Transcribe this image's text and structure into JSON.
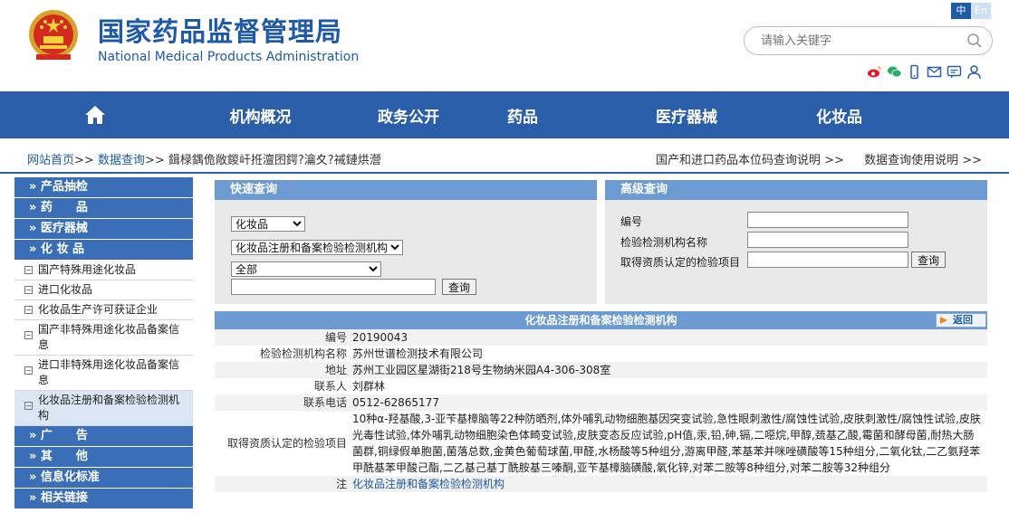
{
  "header": {
    "title_cn": "国家药品监督管理局",
    "title_en": "National Medical Products Administration",
    "lang_zh": "中",
    "lang_en": "En",
    "search_placeholder": "请输入关键字",
    "social_icons": [
      "weibo-icon",
      "wechat-icon",
      "mobile-icon",
      "mail-icon",
      "message-icon",
      "user-icon"
    ]
  },
  "nav": {
    "home_icon": "home-icon",
    "items": [
      "机构概况",
      "政务公开",
      "药品",
      "医疗器械",
      "化妆品"
    ]
  },
  "breadcrumb": {
    "home": "网站首页",
    "sep": ">>",
    "query": "数据查询",
    "current": "鍓椂鍝佹敞鍐屽拰澶囨鍔?瀹夊?祴鏈烘瀯",
    "right_link1": "国产和进口药品本位码查询说明 >>",
    "right_link2": "数据查询使用说明 >>"
  },
  "sidebar": {
    "cat1": "» 产品抽检",
    "cat2": "» 药　　品",
    "cat3": "» 医疗器械",
    "cat4": "» 化 妆 品",
    "subs": [
      "国产特殊用途化妆品",
      "进口化妆品",
      "化妆品生产许可获证企业",
      "国产非特殊用途化妆品备案信息",
      "进口非特殊用途化妆品备案信息",
      "化妆品注册和备案检验检测机构"
    ],
    "cat5": "» 广　　告",
    "cat6": "» 其　　他",
    "cat7": "» 信息化标准",
    "cat8": "» 相关链接"
  },
  "quick": {
    "title": "快速查询",
    "select1": "化妆品",
    "select2": "化妆品注册和备案检验检测机构",
    "select3": "全部",
    "button": "查询"
  },
  "advanced": {
    "title": "高级查询",
    "label1": "编号",
    "label2": "检验检测机构名称",
    "label3": "取得资质认定的检验项目",
    "button": "查询"
  },
  "detail": {
    "title": "化妆品注册和备案检验检测机构",
    "back": "返回",
    "rows": [
      {
        "k": "编号",
        "v": "20190043"
      },
      {
        "k": "检验检测机构名称",
        "v": "苏州世谱检测技术有限公司"
      },
      {
        "k": "地址",
        "v": "苏州工业园区星湖街218号生物纳米园A4-306-308室"
      },
      {
        "k": "联系人",
        "v": "刘群林"
      },
      {
        "k": "联系电话",
        "v": "0512-62865177"
      },
      {
        "k": "取得资质认定的检验项目",
        "v": "10种α-羟基酸,3-亚苄基樟脑等22种防晒剂,体外哺乳动物细胞基因突变试验,急性眼刺激性/腐蚀性试验,皮肤刺激性/腐蚀性试验,皮肤光毒性试验,体外哺乳动物细胞染色体畸变试验,皮肤变态反应试验,pH值,汞,铅,砷,镉,二噁烷,甲醇,巯基乙酸,霉菌和酵母菌,耐热大肠菌群,铜绿假单胞菌,菌落总数,金黄色葡萄球菌,甲醛,水杨酸等5种组分,游离甲醛,苯基苯并咪唑磺酸等15种组分,二氧化钛,二乙氨羟苯甲酰基苯甲酸己酯,二乙基己基丁酰胺基三嗪酮,亚苄基樟脑磺酸,氧化锌,对苯二胺等8种组分,对苯二胺等32种组分"
      },
      {
        "k": "注",
        "v": "化妆品注册和备案检验检测机构"
      }
    ]
  }
}
